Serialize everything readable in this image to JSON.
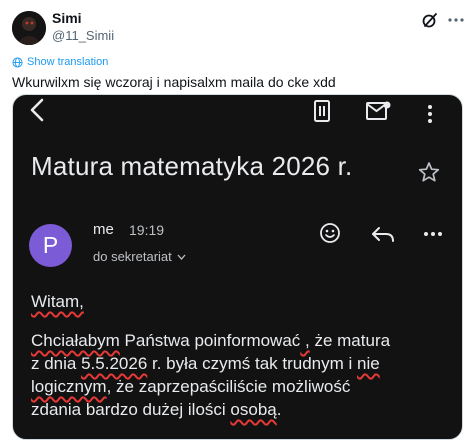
{
  "tweet": {
    "author_name": "Simi",
    "author_handle": "@11_Simii",
    "translation_link": "Show translation",
    "text": "Wkurwilxm się wczoraj i napisalxm maila do cke xdd"
  },
  "icons": {
    "grok": "grok-icon",
    "more": "more-horizontal-icon",
    "translate": "globe-icon"
  },
  "email": {
    "subject": "Matura matematyka 2026 r.",
    "sender": "me",
    "time": "19:19",
    "recipient": "do sekretariat",
    "avatar_letter": "P",
    "avatar_color": "#7b5cd6",
    "greeting": "Witam,",
    "body": {
      "l1_a": "Chciałabym",
      "l1_b": " Państwa poinformować",
      "l1_c": " ,",
      "l1_d": " że matura",
      "l2_a": "z dnia ",
      "l2_b": "5.5.2026",
      "l2_c": " r. była czymś tak trudnym i ",
      "l2_d": "nie",
      "l3_a": "logicznym",
      "l3_b": ", że zaprzepaściliście możliwość",
      "l4_a": "zdania bardzo dużej ilości ",
      "l4_b": "osobą",
      "l4_c": "."
    }
  },
  "colors": {
    "link_blue": "#1d9bf0",
    "spellcheck_red": "#e53935",
    "dark_bg": "#121212"
  }
}
